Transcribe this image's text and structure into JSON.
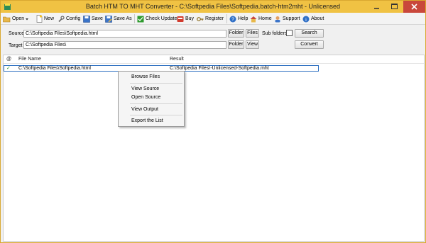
{
  "window": {
    "title": "Batch HTM TO MHT Converter - C:\\Softpedia Files\\Softpedia.batch-htm2mht - Unlicensed"
  },
  "toolbar": {
    "open": "Open",
    "new": "New",
    "config": "Config",
    "save": "Save",
    "save_as": "Save As",
    "check_update": "Check Update",
    "buy": "Buy",
    "register": "Register",
    "help": "Help",
    "home": "Home",
    "support": "Support",
    "about": "About"
  },
  "source": {
    "label": "Source",
    "value": "C:\\Softpedia Files\\Softpedia.html",
    "folder_btn": "Folder",
    "files_btn": "Files",
    "subfolders_label": "Sub folders",
    "search_btn": "Search"
  },
  "target": {
    "label": "Target",
    "value": "C:\\Softpedia Files\\",
    "folder_btn": "Folder",
    "view_btn": "View",
    "convert_btn": "Convert"
  },
  "list": {
    "col_status": "@",
    "col_file": "File Name",
    "col_result": "Result",
    "rows": [
      {
        "status": "✓",
        "file": "C:\\Softpedia Files\\Softpedia.html",
        "result": "C:\\Softpedia Files\\-Unlicensed-Softpedia.mht"
      }
    ]
  },
  "context_menu": {
    "items": [
      "Browse Files",
      "View  Source",
      "Open Source",
      "View  Output",
      "Export the List"
    ]
  },
  "colors": {
    "titlebar": "#f0c243",
    "close_button": "#c9473b",
    "selection_border": "#2d6fc0",
    "check_green": "#2e9a2e"
  }
}
